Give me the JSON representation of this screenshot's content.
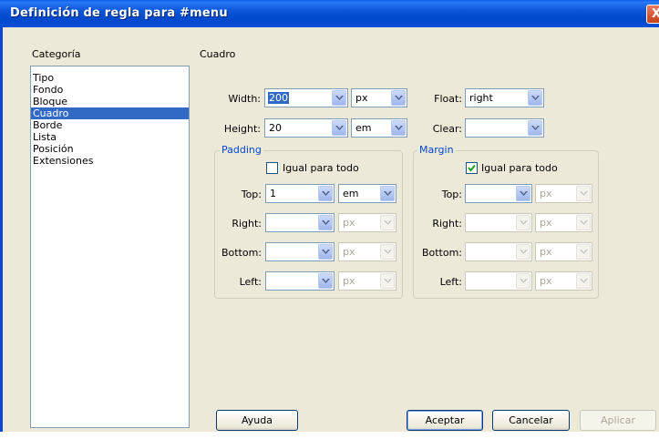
{
  "window": {
    "title": "Definición de regla para #menu",
    "close_label": "X"
  },
  "categories": {
    "label": "Categoría",
    "items": [
      "Tipo",
      "Fondo",
      "Bloque",
      "Cuadro",
      "Borde",
      "Lista",
      "Posición",
      "Extensiones"
    ],
    "selected": "Cuadro"
  },
  "section": {
    "title": "Cuadro"
  },
  "box": {
    "width": {
      "label": "Width:",
      "value": "200",
      "unit": "px"
    },
    "height": {
      "label": "Height:",
      "value": "20",
      "unit": "em"
    },
    "float": {
      "label": "Float:",
      "value": "right"
    },
    "clear": {
      "label": "Clear:",
      "value": ""
    }
  },
  "padding": {
    "title": "Padding",
    "same_label": "Igual para todo",
    "same_checked": false,
    "top": {
      "label": "Top:",
      "value": "1",
      "unit": "em"
    },
    "right": {
      "label": "Right:",
      "value": "",
      "unit": "px"
    },
    "bottom": {
      "label": "Bottom:",
      "value": "",
      "unit": "px"
    },
    "left": {
      "label": "Left:",
      "value": "",
      "unit": "px"
    }
  },
  "margin": {
    "title": "Margin",
    "same_label": "Igual para todo",
    "same_checked": true,
    "top": {
      "label": "Top:",
      "value": "",
      "unit": "px"
    },
    "right": {
      "label": "Right:",
      "value": "",
      "unit": "px"
    },
    "bottom": {
      "label": "Bottom:",
      "value": "",
      "unit": "px"
    },
    "left": {
      "label": "Left:",
      "value": "",
      "unit": "px"
    }
  },
  "buttons": {
    "help": "Ayuda",
    "ok": "Aceptar",
    "cancel": "Cancelar",
    "apply": "Aplicar"
  },
  "colors": {
    "titlebar": "#0a55d8",
    "selection": "#316ac5",
    "group_title": "#0046d5",
    "dialog_bg": "#ece9d8"
  }
}
